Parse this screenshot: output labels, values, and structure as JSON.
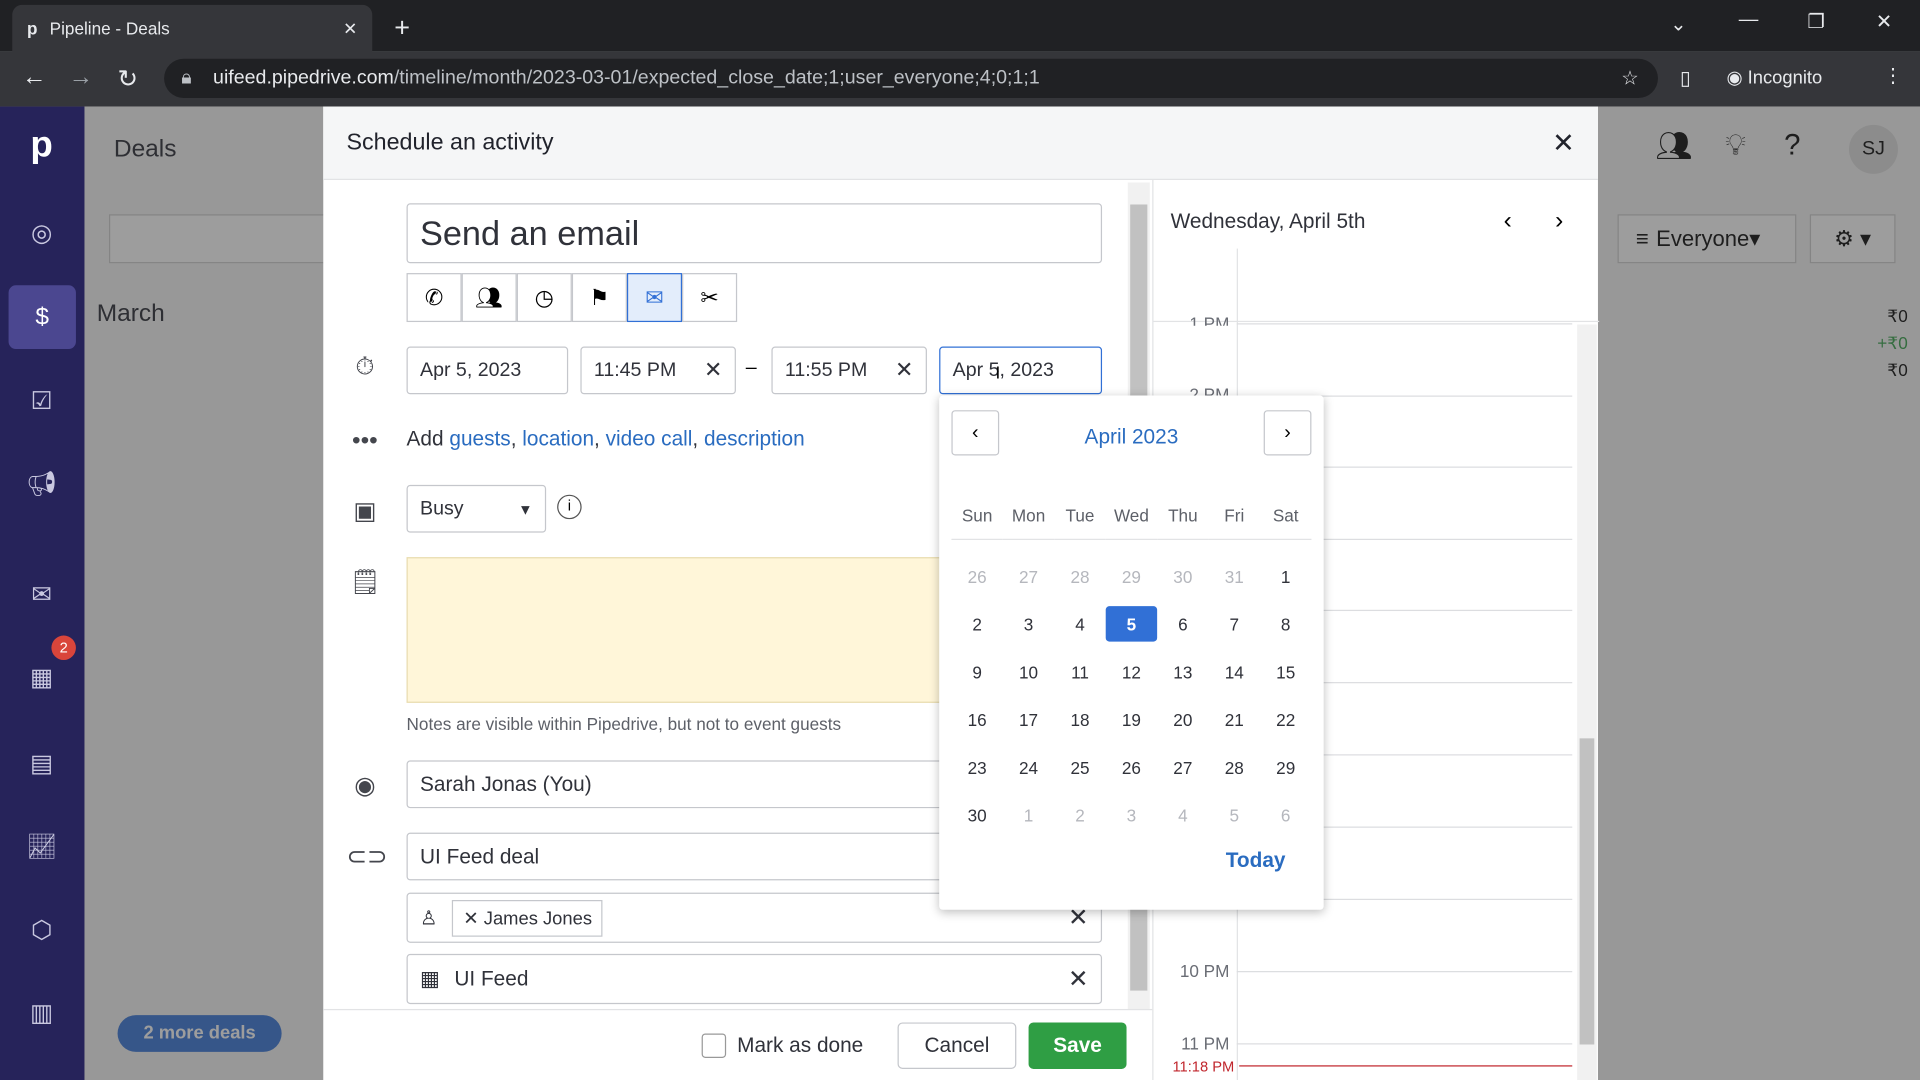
{
  "browser": {
    "tab_title": "Pipeline - Deals",
    "url_host": "uifeed.pipedrive.com",
    "url_path": "/timeline/month/2023-03-01/expected_close_date;1;user_everyone;4;0;1;1",
    "profile": "Incognito"
  },
  "app": {
    "page_title": "Deals",
    "month": "March",
    "filter": "Everyone",
    "avatar": "SJ",
    "more_deals": "2 more deals",
    "sums": [
      "₹0",
      "+₹0",
      "₹0"
    ],
    "calendar_badge": "2",
    "brand_color": "#26235a"
  },
  "modal": {
    "title": "Schedule an activity",
    "subject": "Send an email",
    "activity_types": [
      "call",
      "meeting",
      "task",
      "deadline",
      "email",
      "lunch"
    ],
    "selected_type": "email",
    "start_date": "Apr 5, 2023",
    "start_time": "11:45 PM",
    "end_time": "11:55 PM",
    "end_date": "Apr 5, 2023",
    "dash": "–",
    "add_prefix": "Add",
    "add_links": [
      "guests",
      "location",
      "video call",
      "description"
    ],
    "busy": "Busy",
    "notes_hint": "Notes are visible within Pipedrive, but not to event guests",
    "owner": "Sarah Jonas (You)",
    "deal": "UI Feed deal",
    "person": "James Jones",
    "organization": "UI Feed",
    "mark_done": "Mark as done",
    "cancel": "Cancel",
    "save": "Save",
    "save_color": "#2f9e44"
  },
  "datepicker": {
    "month": "April 2023",
    "weekdays": [
      "Sun",
      "Mon",
      "Tue",
      "Wed",
      "Thu",
      "Fri",
      "Sat"
    ],
    "days": [
      [
        "26",
        "m"
      ],
      [
        "27",
        "m"
      ],
      [
        "28",
        "m"
      ],
      [
        "29",
        "m"
      ],
      [
        "30",
        "m"
      ],
      [
        "31",
        "m"
      ],
      [
        "1",
        ""
      ],
      [
        "2",
        ""
      ],
      [
        "3",
        ""
      ],
      [
        "4",
        ""
      ],
      [
        "5",
        "s"
      ],
      [
        "6",
        ""
      ],
      [
        "7",
        ""
      ],
      [
        "8",
        ""
      ],
      [
        "9",
        ""
      ],
      [
        "10",
        ""
      ],
      [
        "11",
        ""
      ],
      [
        "12",
        ""
      ],
      [
        "13",
        ""
      ],
      [
        "14",
        ""
      ],
      [
        "15",
        ""
      ],
      [
        "16",
        ""
      ],
      [
        "17",
        ""
      ],
      [
        "18",
        ""
      ],
      [
        "19",
        ""
      ],
      [
        "20",
        ""
      ],
      [
        "21",
        ""
      ],
      [
        "22",
        ""
      ],
      [
        "23",
        ""
      ],
      [
        "24",
        ""
      ],
      [
        "25",
        ""
      ],
      [
        "26",
        ""
      ],
      [
        "27",
        ""
      ],
      [
        "28",
        ""
      ],
      [
        "29",
        ""
      ],
      [
        "30",
        ""
      ],
      [
        "1",
        "m"
      ],
      [
        "2",
        "m"
      ],
      [
        "3",
        "m"
      ],
      [
        "4",
        "m"
      ],
      [
        "5",
        "m"
      ],
      [
        "6",
        "m"
      ]
    ],
    "today": "Today",
    "selected_day": "5"
  },
  "agenda": {
    "title": "Wednesday, April 5th",
    "hours": [
      "1 PM",
      "2 PM",
      "10 PM",
      "11 PM"
    ],
    "now": "11:18 PM"
  }
}
